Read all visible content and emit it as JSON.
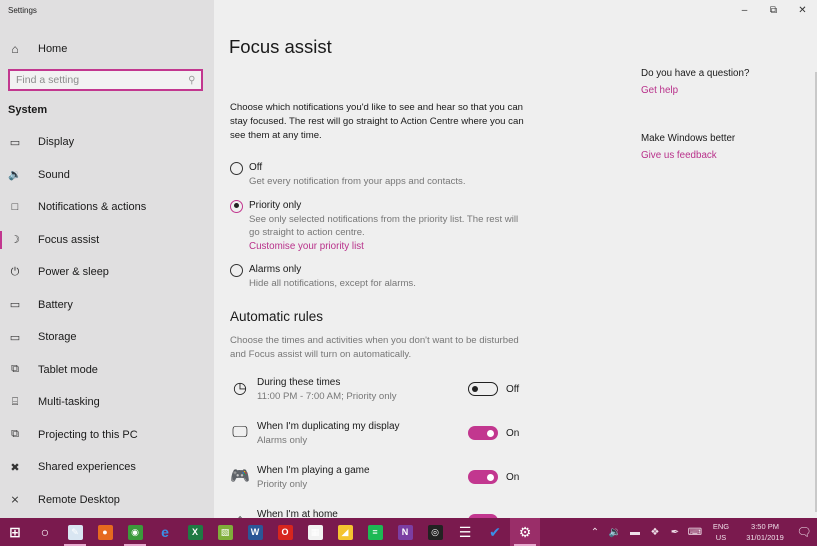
{
  "window": {
    "app_title": "Settings",
    "controls": {
      "minimize": "–",
      "restore": "⧉",
      "close": "✕"
    }
  },
  "sidebar": {
    "home_label": "Home",
    "search_placeholder": "Find a setting",
    "section_title": "System",
    "items": [
      {
        "label": "Display",
        "icon": "display-icon",
        "glyph": "▭",
        "active": false
      },
      {
        "label": "Sound",
        "icon": "sound-icon",
        "glyph": "🔉",
        "active": false
      },
      {
        "label": "Notifications & actions",
        "icon": "notifications-icon",
        "glyph": "□",
        "active": false
      },
      {
        "label": "Focus assist",
        "icon": "moon-icon",
        "glyph": "☽",
        "active": true
      },
      {
        "label": "Power & sleep",
        "icon": "power-icon",
        "glyph": "⏻",
        "active": false
      },
      {
        "label": "Battery",
        "icon": "battery-icon",
        "glyph": "▭",
        "active": false
      },
      {
        "label": "Storage",
        "icon": "storage-icon",
        "glyph": "▭",
        "active": false
      },
      {
        "label": "Tablet mode",
        "icon": "tablet-mode-icon",
        "glyph": "⧉",
        "active": false
      },
      {
        "label": "Multi-tasking",
        "icon": "multitasking-icon",
        "glyph": "⌸",
        "active": false
      },
      {
        "label": "Projecting to this PC",
        "icon": "projecting-icon",
        "glyph": "⧉",
        "active": false
      },
      {
        "label": "Shared experiences",
        "icon": "shared-experiences-icon",
        "glyph": "✖",
        "active": false
      },
      {
        "label": "Remote Desktop",
        "icon": "remote-desktop-icon",
        "glyph": "⨯",
        "active": false
      }
    ]
  },
  "main": {
    "title": "Focus assist",
    "intro": "Choose which notifications you'd like to see and hear so that you can stay focused. The rest will go straight to Action Centre where you can see them at any time.",
    "options": [
      {
        "label": "Off",
        "desc": "Get every notification from your apps and contacts.",
        "checked": false
      },
      {
        "label": "Priority only",
        "desc": "See only selected notifications from the priority list. The rest will go straight to action centre.",
        "link": "Customise your priority list",
        "checked": true
      },
      {
        "label": "Alarms only",
        "desc": "Hide all notifications, except for alarms.",
        "checked": false
      }
    ],
    "automatic_rules": {
      "title": "Automatic rules",
      "desc": "Choose the times and activities when you don't want to be disturbed and Focus assist will turn on automatically.",
      "rules": [
        {
          "name": "During these times",
          "sub": "11:00 PM - 7:00 AM; Priority only",
          "state": "Off",
          "on": false,
          "icon": "clock-icon",
          "glyph": "◷"
        },
        {
          "name": "When I'm duplicating my display",
          "sub": "Alarms only",
          "state": "On",
          "on": true,
          "icon": "monitor-icon",
          "glyph": "🖵"
        },
        {
          "name": "When I'm playing a game",
          "sub": "Priority only",
          "state": "On",
          "on": true,
          "icon": "gamepad-icon",
          "glyph": "🎮"
        },
        {
          "name": "When I'm at home",
          "sub": "",
          "state": "",
          "on": true,
          "icon": "home-icon",
          "glyph": "⌂"
        }
      ]
    }
  },
  "aside": {
    "question": "Do you have a question?",
    "get_help": "Get help",
    "improve": "Make Windows better",
    "feedback": "Give us feedback"
  },
  "taskbar": {
    "apps": [
      {
        "name": "start-icon",
        "glyph": "⊞",
        "bg": "transparent",
        "running": false
      },
      {
        "name": "cortana-icon",
        "glyph": "○",
        "bg": "transparent",
        "running": false
      },
      {
        "name": "sketch-app-icon",
        "glyph": "✎",
        "bg": "#d9e6f2",
        "running": true
      },
      {
        "name": "firefox-icon",
        "glyph": "●",
        "bg": "#e66a1f",
        "running": false
      },
      {
        "name": "chrome-icon",
        "glyph": "◉",
        "bg": "#3b9a3b",
        "running": true
      },
      {
        "name": "edge-icon",
        "glyph": "e",
        "bg": "transparent",
        "running": false
      },
      {
        "name": "excel-icon",
        "glyph": "X",
        "bg": "#1f7a43",
        "running": false
      },
      {
        "name": "image-app-icon",
        "glyph": "▧",
        "bg": "#7fae3a",
        "running": false
      },
      {
        "name": "word-icon",
        "glyph": "W",
        "bg": "#2b5797",
        "running": false
      },
      {
        "name": "opera-icon",
        "glyph": "O",
        "bg": "#d7261e",
        "running": false
      },
      {
        "name": "store-icon",
        "glyph": "▦",
        "bg": "#f2f2f2",
        "running": false
      },
      {
        "name": "sticky-notes-icon",
        "glyph": "◢",
        "bg": "#f4c430",
        "running": false
      },
      {
        "name": "spotify-icon",
        "glyph": "≡",
        "bg": "#1db954",
        "running": false
      },
      {
        "name": "onenote-icon",
        "glyph": "N",
        "bg": "#7b3ea3",
        "running": false
      },
      {
        "name": "obs-icon",
        "glyph": "◎",
        "bg": "#222222",
        "running": false
      },
      {
        "name": "database-icon",
        "glyph": "☰",
        "bg": "transparent",
        "running": false
      },
      {
        "name": "todo-icon",
        "glyph": "✔",
        "bg": "transparent",
        "running": false
      },
      {
        "name": "settings-gear-icon",
        "glyph": "⚙",
        "bg": "transparent",
        "running": true,
        "active": true
      }
    ],
    "tray": [
      {
        "name": "show-hidden-icons-chevron-icon",
        "glyph": "⌃"
      },
      {
        "name": "volume-icon",
        "glyph": "🔉"
      },
      {
        "name": "battery-tray-icon",
        "glyph": "▬"
      },
      {
        "name": "dropbox-icon",
        "glyph": "❖"
      },
      {
        "name": "pen-icon",
        "glyph": "✒"
      },
      {
        "name": "touch-keyboard-icon",
        "glyph": "⌨"
      }
    ],
    "lang_top": "ENG",
    "lang_bottom": "US",
    "time": "3:50 PM",
    "date": "31/01/2019",
    "notification_glyph": "🗨"
  },
  "colors": {
    "accent": "#c2378f",
    "taskbar": "#7a1a4e",
    "link": "#b8308a"
  }
}
